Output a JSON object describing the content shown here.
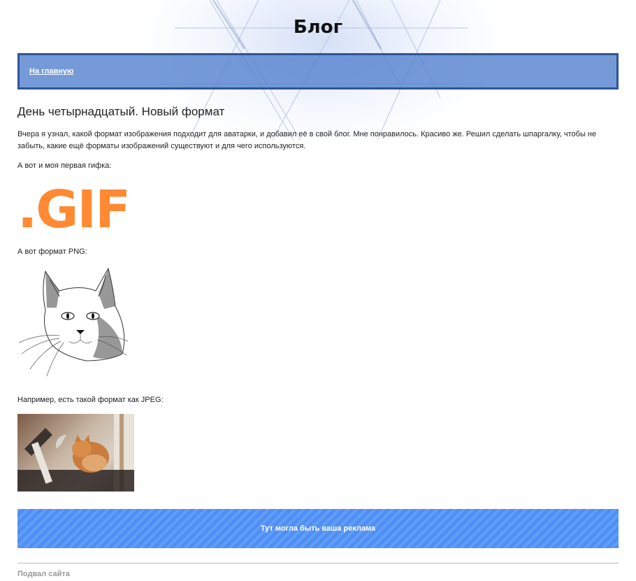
{
  "header": {
    "title": "Блог"
  },
  "nav": {
    "home_link": "На главную"
  },
  "post": {
    "title": "День четырнадцатый. Новый формат",
    "intro": "Вчера я узнал, какой формат изображения подходит для аватарки, и добавил её в свой блог. Мне понравилось. Красиво же. Решил сделать шпаргалку, чтобы не забыть, какие ещё форматы изображений существуют и для чего используются.",
    "gif_caption": "А вот и моя первая гифка:",
    "gif_logo_text": ".GIF",
    "png_caption": "А вот формат PNG:",
    "jpeg_caption": "Например, есть такой формат как JPEG:"
  },
  "ad": {
    "text": "Тут могла быть ваша реклама"
  },
  "footer": {
    "text": "Подвал сайта"
  },
  "colors": {
    "nav_bg": "#6f94d8",
    "nav_border": "#2f5597",
    "gif_orange": "#ff8a33",
    "ad_bg": "#4d8ff5"
  }
}
